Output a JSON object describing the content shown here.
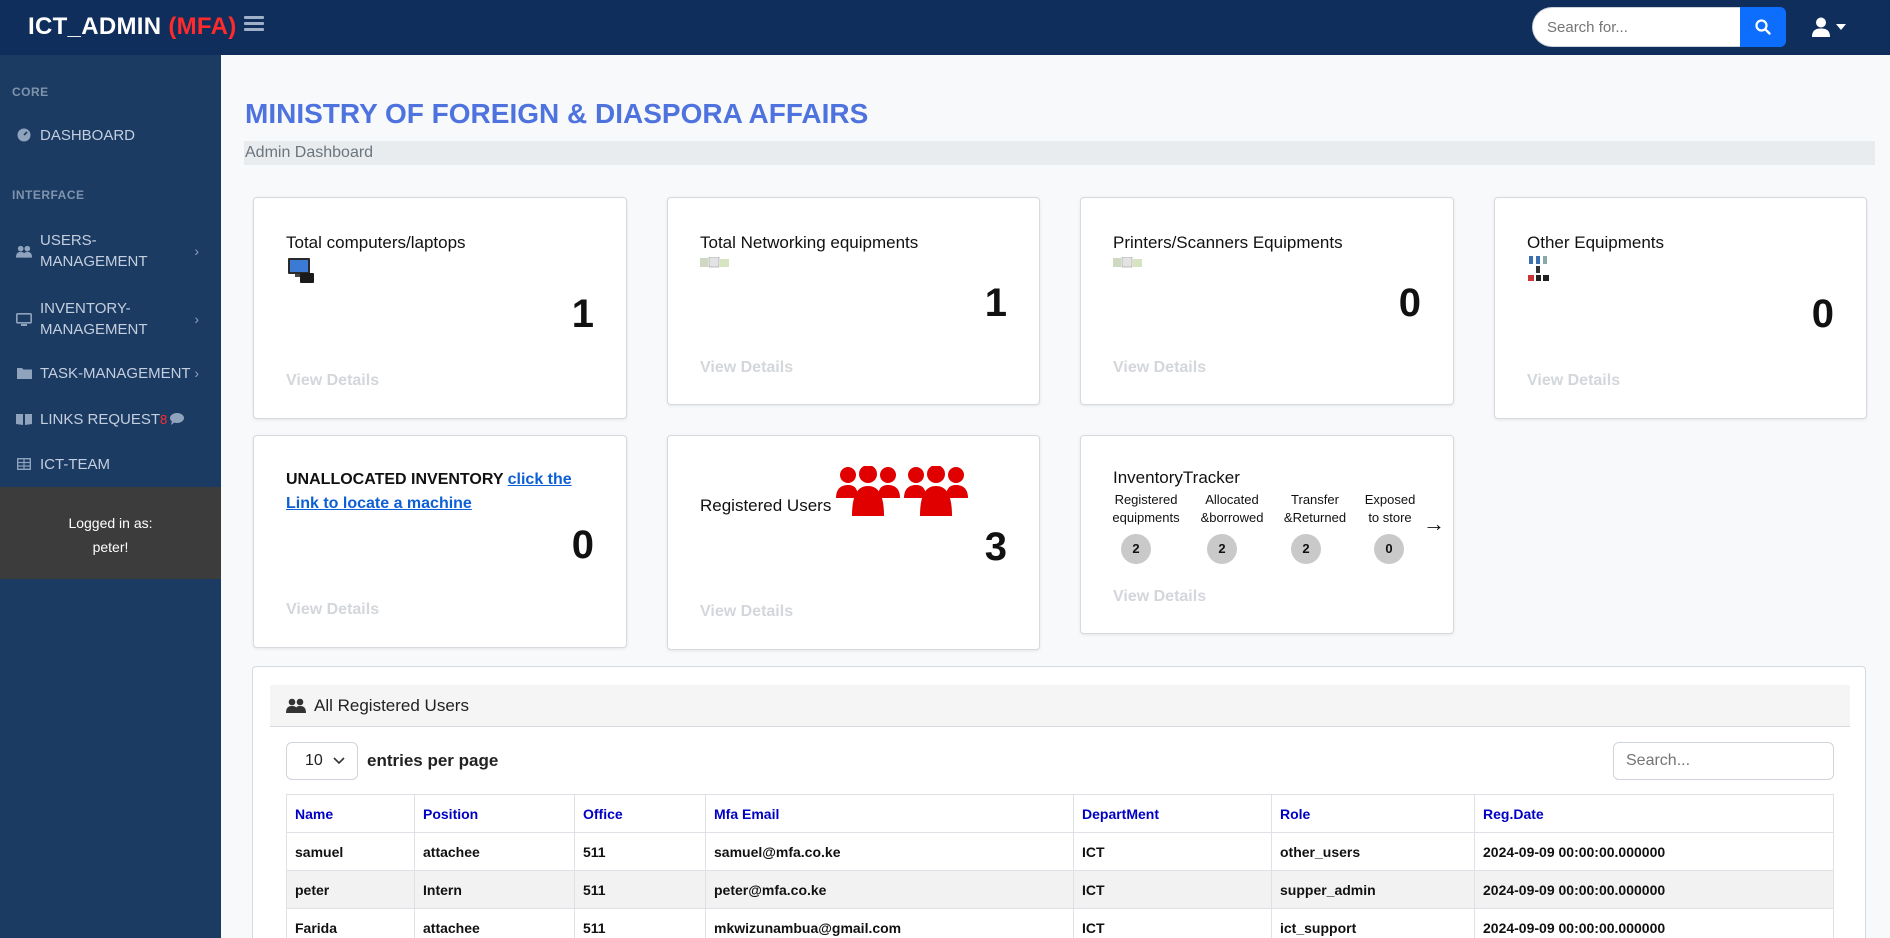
{
  "topbar": {
    "brand_main": "ICT_ADMIN",
    "brand_tag": "(MFA)",
    "search_placeholder": "Search for...",
    "icons": {
      "menu": "hamburger-icon",
      "search": "search-icon",
      "user": "user-icon"
    }
  },
  "sidebar": {
    "core_heading": "CORE",
    "interface_heading": "INTERFACE",
    "items": [
      {
        "label": "DASHBOARD",
        "icon": "tachometer-icon"
      },
      {
        "label": "USERS-MANAGEMENT",
        "line1": "USERS-",
        "line2": "MANAGEMENT",
        "icon": "users-icon"
      },
      {
        "label": "INVENTORY-MANAGEMENT",
        "line1": "INVENTORY-",
        "line2": "MANAGEMENT",
        "icon": "desktop-icon"
      },
      {
        "label": "TASK-MANAGEMENT",
        "icon": "folder-icon"
      },
      {
        "label": "LINKS REQUEST",
        "badge": "8",
        "icon": "book-icon"
      },
      {
        "label": "ICT-TEAM",
        "icon": "table-icon"
      }
    ],
    "logged_in_label": "Logged in as:",
    "logged_in_user": "peter!"
  },
  "main": {
    "title": "MINISTRY OF FOREIGN & DIASPORA AFFAIRS",
    "breadcrumb": "Admin Dashboard",
    "view_details": "View Details",
    "cards": {
      "computers": {
        "title": "Total computers/laptops",
        "value": "1"
      },
      "networking": {
        "title": "Total Networking equipments",
        "value": "1"
      },
      "printers": {
        "title": "Printers/Scanners Equipments",
        "value": "0"
      },
      "other": {
        "title": "Other Equipments",
        "value": "0"
      },
      "unallocated": {
        "title": "UNALLOCATED INVENTORY ",
        "link": "click the Link to locate a machine",
        "value": "0"
      },
      "users": {
        "title": "Registered Users",
        "value": "3"
      },
      "tracker": {
        "title": "InventoryTracker",
        "arrow": "→",
        "columns": [
          {
            "line1": "Registered",
            "line2": "equipments",
            "value": "2"
          },
          {
            "line1": "Allocated",
            "line2": "&borrowed",
            "value": "2"
          },
          {
            "line1": "Transfer",
            "line2": "&Returned",
            "value": "2"
          },
          {
            "line1": "Exposed",
            "line2": "to store",
            "value": "0"
          }
        ]
      }
    },
    "users_table": {
      "heading": "All Registered Users",
      "entries_value": "10",
      "entries_label": "entries per page",
      "search_placeholder": "Search...",
      "columns": [
        "Name",
        "Position",
        "Office",
        "Mfa Email",
        "DepartMent",
        "Role",
        "Reg.Date"
      ],
      "rows": [
        [
          "samuel",
          "attachee",
          "511",
          "samuel@mfa.co.ke",
          "ICT",
          "other_users",
          "2024-09-09 00:00:00.000000"
        ],
        [
          "peter",
          "Intern",
          "511",
          "peter@mfa.co.ke",
          "ICT",
          "supper_admin",
          "2024-09-09 00:00:00.000000"
        ],
        [
          "Farida",
          "attachee",
          "511",
          "mkwizunambua@gmail.com",
          "ICT",
          "ict_support",
          "2024-09-09 00:00:00.000000"
        ]
      ]
    }
  },
  "colors": {
    "topbar": "#0f2e5c",
    "sidebar": "#1c3b63",
    "title": "#4e73df",
    "accent_red": "#ff2b2b",
    "search_button": "#0d6efd"
  }
}
